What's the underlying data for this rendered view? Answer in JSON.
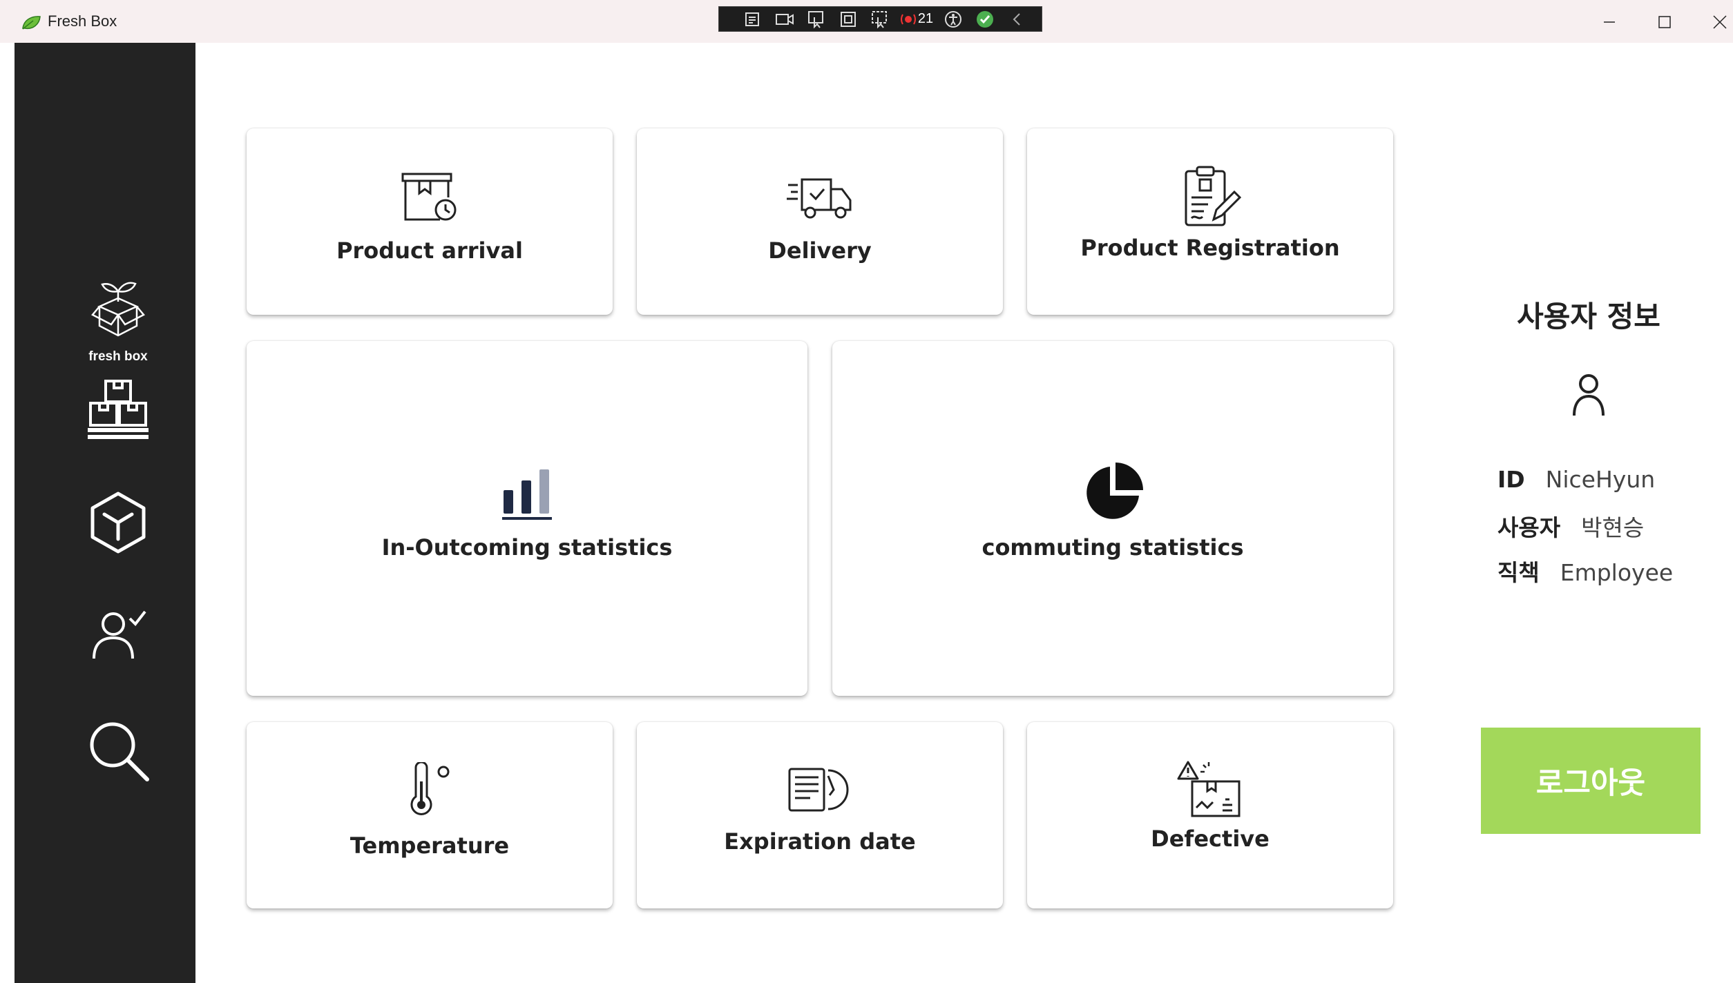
{
  "window": {
    "title": "Fresh Box"
  },
  "recorder_toolbar": {
    "count": "21"
  },
  "sidebar": {
    "logo_text": "fresh box",
    "items": [
      {
        "icon": "pallet-boxes-icon"
      },
      {
        "icon": "cube-icon"
      },
      {
        "icon": "user-check-icon"
      },
      {
        "icon": "search-icon"
      }
    ]
  },
  "cards": {
    "product_arrival": "Product arrival",
    "delivery": "Delivery",
    "product_registration": "Product Registration",
    "inout_statistics": "In-Outcoming statistics",
    "commuting_statistics": "commuting statistics",
    "temperature": "Temperature",
    "expiration_date": "Expiration date",
    "defective": "Defective"
  },
  "user_info": {
    "title": "사용자 정보",
    "id_label": "ID",
    "id_value": "NiceHyun",
    "user_label": "사용자",
    "user_value": "박현승",
    "position_label": "직책",
    "position_value": "Employee",
    "logout_label": "로그아웃"
  },
  "colors": {
    "sidebar": "#232323",
    "accent": "#a3d85a",
    "titlebar": "#f7eff0"
  }
}
